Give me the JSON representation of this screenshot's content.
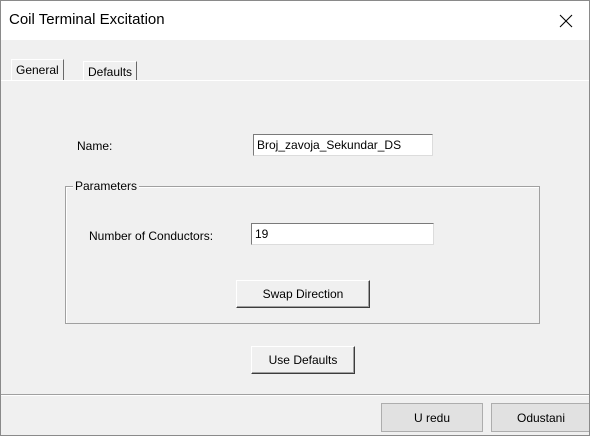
{
  "window": {
    "title": "Coil Terminal Excitation",
    "close_icon": "close-icon"
  },
  "tabs": [
    {
      "label": "General",
      "active": true
    },
    {
      "label": "Defaults",
      "active": false
    }
  ],
  "general": {
    "name_label": "Name:",
    "name_value": "Broj_zavoja_Sekundar_DS",
    "parameters": {
      "legend": "Parameters",
      "conductors_label": "Number of Conductors:",
      "conductors_value": "19",
      "swap_label": "Swap Direction"
    },
    "use_defaults_label": "Use Defaults"
  },
  "footer": {
    "ok_label": "U redu",
    "cancel_label": "Odustani"
  }
}
